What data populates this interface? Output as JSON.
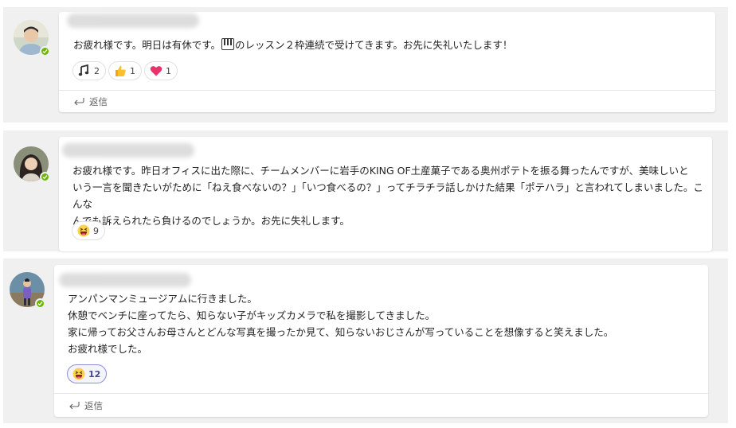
{
  "posts": [
    {
      "message_lines": [
        "お疲れ様です。明日は有休です。",
        "のレッスン２枠連続で受けてきます。お先に失礼いたします！"
      ],
      "reactions": [
        {
          "icon": "music-notes-icon",
          "count": "2"
        },
        {
          "icon": "thumbs-up-icon",
          "count": "1"
        },
        {
          "icon": "heart-icon",
          "count": "1"
        }
      ],
      "reply_label": "返信"
    },
    {
      "message_lines": [
        "お疲れ様です。昨日オフィスに出た際に、チームメンバーに岩手のKING OF土産菓子である奥州ポテトを振る舞ったんですが、美味しいと",
        "いう一言を聞きたいがために「ねえ食べないの？」「いつ食べるの？」ってチラチラ話しかけた結果「ポテハラ」と言われてしまいました。こんな",
        "んでも訴えられたら負けるのでしょうか。お先に失礼します。"
      ],
      "reactions": [
        {
          "icon": "laughing-face-icon",
          "count": "9"
        }
      ]
    },
    {
      "message_lines": [
        "アンパンマンミュージアムに行きました。",
        "休憩でベンチに座ってたら、知らない子がキッズカメラで私を撮影してきました。",
        "家に帰ってお父さんお母さんとどんな写真を撮ったか見て、知らないおじさんが写っていることを想像すると笑えました。",
        "お疲れ様でした。"
      ],
      "reactions": [
        {
          "icon": "laughing-face-icon",
          "count": "12"
        }
      ],
      "reply_label": "返信"
    }
  ],
  "colors": {
    "status_available": "#6bb700",
    "accent": "#444791"
  }
}
